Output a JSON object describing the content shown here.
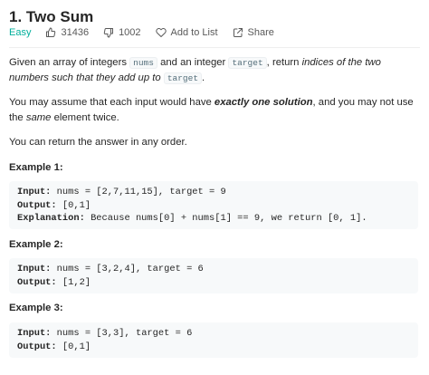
{
  "problem": {
    "title": "1. Two Sum",
    "difficulty": "Easy",
    "likes": "31436",
    "dislikes": "1002",
    "add_to_list": "Add to List",
    "share": "Share"
  },
  "description": {
    "p1_a": "Given an array of integers ",
    "p1_code1": "nums",
    "p1_b": " and an integer ",
    "p1_code2": "target",
    "p1_c": ", return ",
    "p1_em": "indices of the two numbers such that they add up to ",
    "p1_code3": "target",
    "p1_d": ".",
    "p2_a": "You may assume that each input would have ",
    "p2_strong": "exactly one solution",
    "p2_b": ", and you may not use the ",
    "p2_em": "same",
    "p2_c": " element twice.",
    "p3": "You can return the answer in any order."
  },
  "examples": [
    {
      "title": "Example 1:",
      "input_label": "Input:",
      "input": " nums = [2,7,11,15], target = 9",
      "output_label": "Output:",
      "output": " [0,1]",
      "explanation_label": "Explanation:",
      "explanation": " Because nums[0] + nums[1] == 9, we return [0, 1]."
    },
    {
      "title": "Example 2:",
      "input_label": "Input:",
      "input": " nums = [3,2,4], target = 6",
      "output_label": "Output:",
      "output": " [1,2]"
    },
    {
      "title": "Example 3:",
      "input_label": "Input:",
      "input": " nums = [3,3], target = 6",
      "output_label": "Output:",
      "output": " [0,1]"
    }
  ],
  "colors": {
    "easy": "#00af9b",
    "code_bg": "#f7f9fa",
    "text": "#262626",
    "muted": "#595959"
  },
  "icons": [
    "thumbs-up-icon",
    "thumbs-down-icon",
    "heart-icon",
    "share-icon"
  ]
}
